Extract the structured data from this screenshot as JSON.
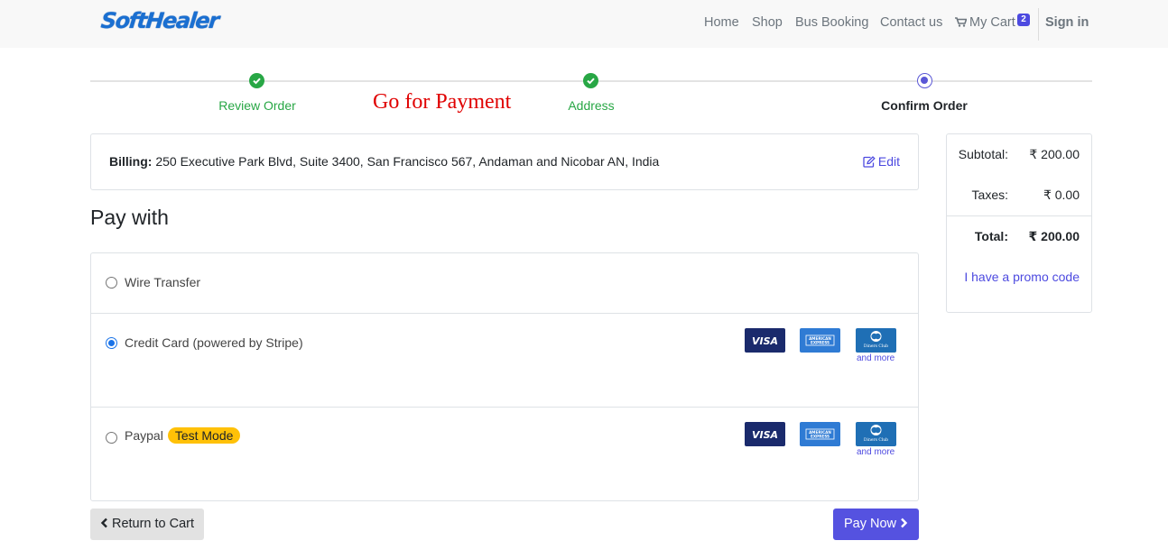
{
  "brand": {
    "logo_text": "SoftHealer",
    "brand_color": "#1a6fd1"
  },
  "nav": {
    "items": [
      {
        "label": "Home"
      },
      {
        "label": "Shop"
      },
      {
        "label": "Bus Booking"
      },
      {
        "label": "Contact us"
      }
    ],
    "cart_label": "My Cart",
    "cart_count": "2",
    "cart_icon": "shopping-cart-icon",
    "signin_label": "Sign in"
  },
  "progress": {
    "steps": [
      {
        "label": "Review Order",
        "status": "done"
      },
      {
        "label": "Address",
        "status": "done"
      },
      {
        "label": "Confirm Order",
        "status": "current"
      }
    ],
    "annotation": "Go for Payment",
    "done_color": "#28a745",
    "current_color": "#5a57d6"
  },
  "billing": {
    "label": "Billing:",
    "address": "250 Executive Park Blvd, Suite 3400, San Francisco 567, Andaman and Nicobar AN, India",
    "edit_label": "Edit",
    "edit_icon": "edit-icon"
  },
  "payment": {
    "heading": "Pay with",
    "methods": [
      {
        "label": "Wire Transfer",
        "selected": false,
        "badge": ""
      },
      {
        "label": "Credit Card (powered by Stripe)",
        "selected": true,
        "badge": "",
        "cards": [
          "VISA",
          "AMERICAN EXPRESS",
          "Diners Club"
        ],
        "more_label": "and more"
      },
      {
        "label": "Paypal",
        "selected": false,
        "badge": "Test Mode",
        "cards": [
          "VISA",
          "AMERICAN EXPRESS",
          "Diners Club"
        ],
        "more_label": "and more"
      }
    ]
  },
  "actions": {
    "return_label": "Return to Cart",
    "pay_label": "Pay Now",
    "pay_color": "#5552e0"
  },
  "summary": {
    "subtotal_label": "Subtotal:",
    "subtotal_value": "₹ 200.00",
    "taxes_label": "Taxes:",
    "taxes_value": "₹ 0.00",
    "total_label": "Total:",
    "total_value": "₹ 200.00",
    "promo_label": "I have a promo code"
  }
}
